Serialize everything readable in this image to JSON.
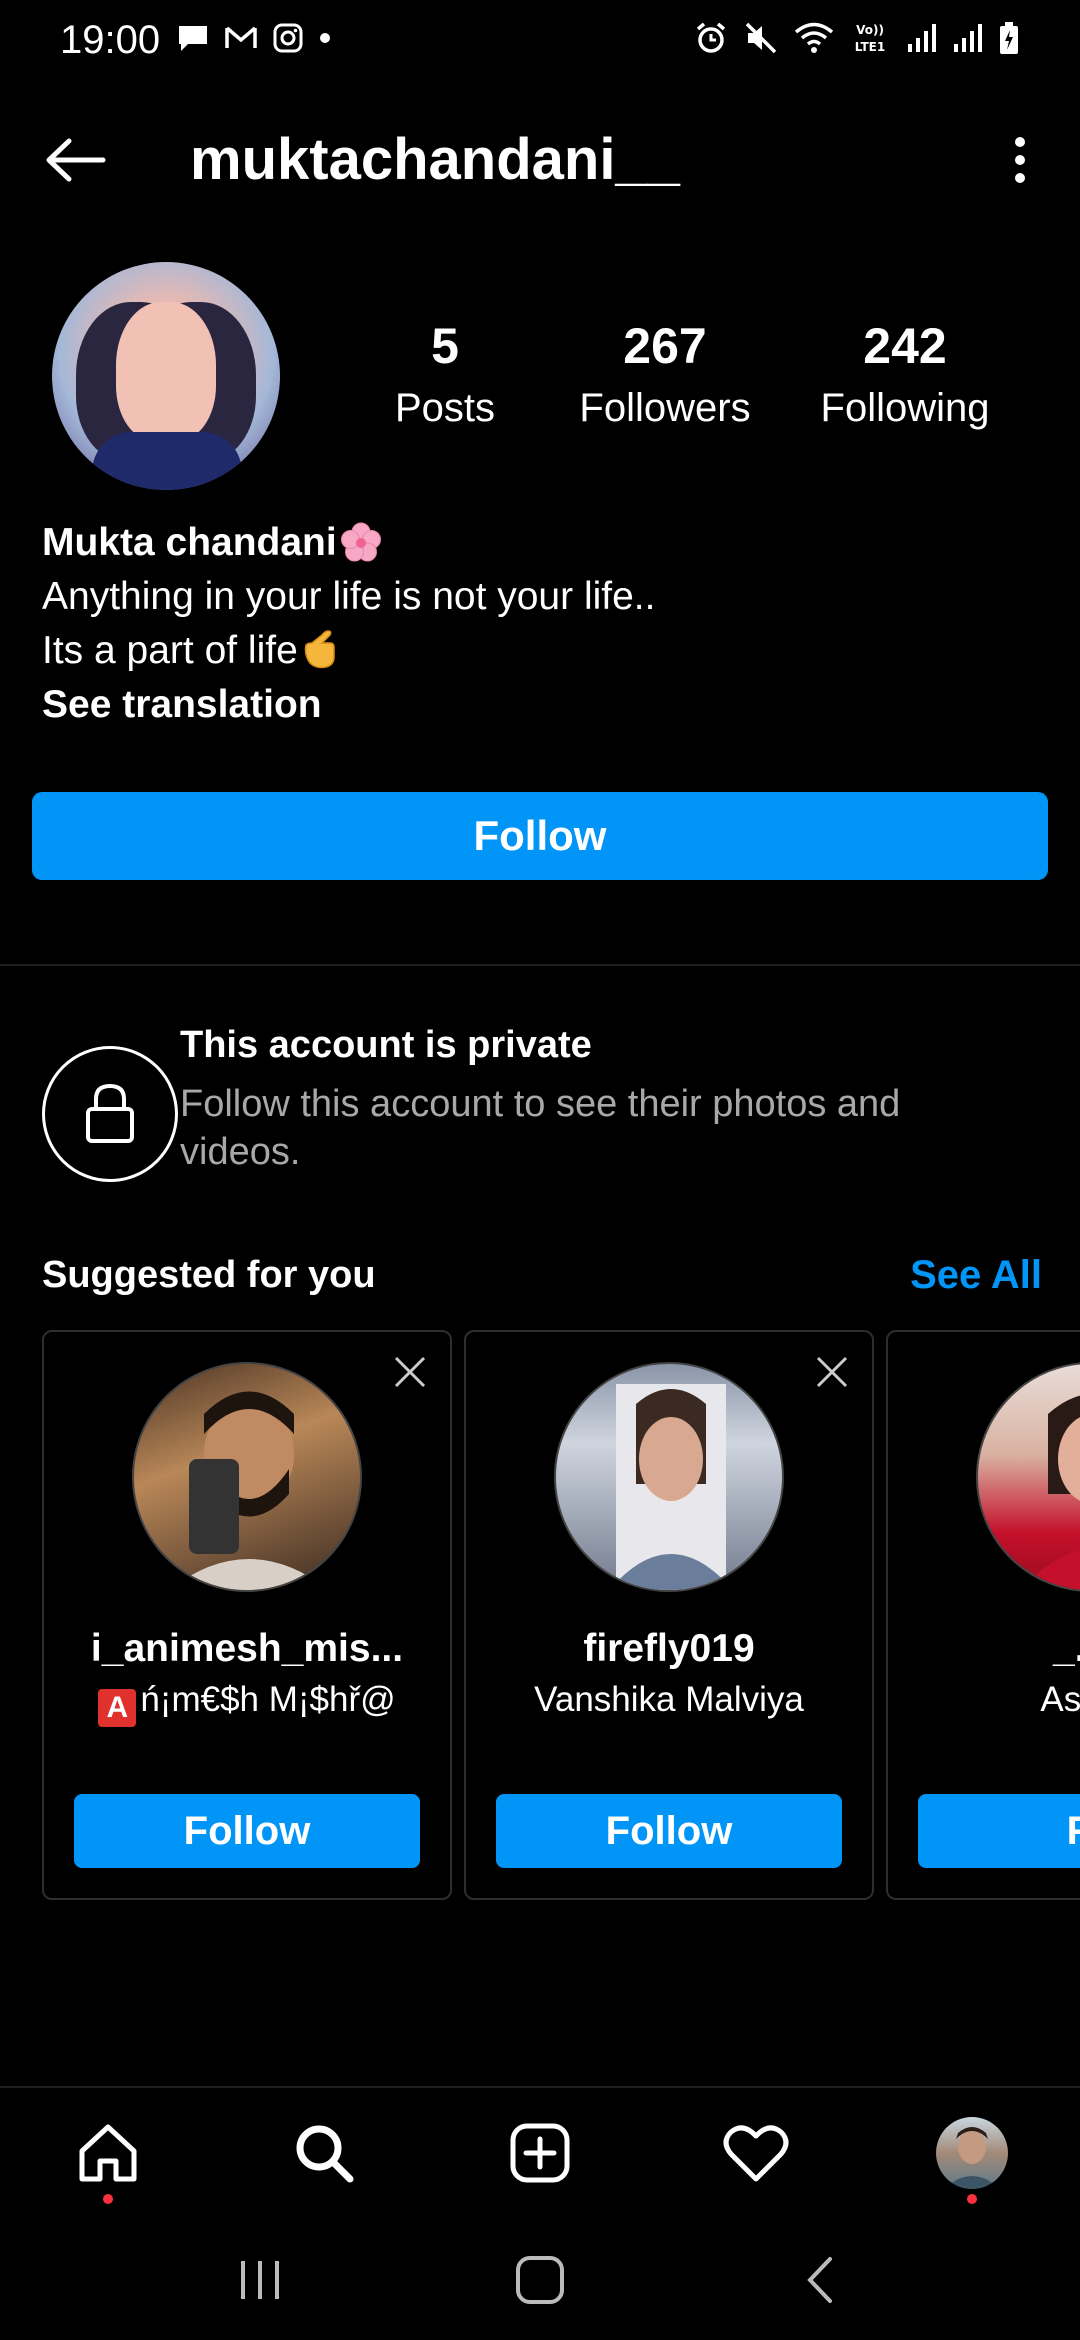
{
  "status_bar": {
    "time": "19:00",
    "left_icons": [
      "chat-icon",
      "gmail-icon",
      "instagram-icon",
      "dot-icon"
    ],
    "right_icons": [
      "alarm-icon",
      "mute-icon",
      "wifi-icon",
      "volte-icon",
      "signal-icon",
      "signal-icon",
      "battery-icon"
    ]
  },
  "header": {
    "username": "muktachandani__"
  },
  "profile": {
    "stats": [
      {
        "value": "5",
        "label": "Posts"
      },
      {
        "value": "267",
        "label": "Followers"
      },
      {
        "value": "242",
        "label": "Following"
      }
    ],
    "bio": {
      "name": "Mukta chandani",
      "line1": "Anything in your life is not your life..",
      "line2": "Its a part of life",
      "translate": "See translation"
    },
    "follow_label": "Follow"
  },
  "private": {
    "title": "This account is private",
    "description": "Follow this account to see their photos and videos."
  },
  "suggested": {
    "title": "Suggested for you",
    "see_all": "See All",
    "cards": [
      {
        "username": "i_animesh_mis...",
        "fullname": "ń¡m€$h M¡$hř@",
        "follow": "Follow"
      },
      {
        "username": "firefly019",
        "fullname": "Vanshika Malviya",
        "follow": "Follow"
      },
      {
        "username": "_.aa",
        "fullname": "Ashi S",
        "follow": "Fo"
      }
    ]
  },
  "bottom_nav": [
    "home-icon",
    "search-icon",
    "add-post-icon",
    "activity-heart-icon",
    "profile-avatar"
  ],
  "colors": {
    "accent": "#0095f6",
    "background": "#000000",
    "notification_dot": "#ff3040",
    "secondary_text": "#a8a8a8"
  }
}
